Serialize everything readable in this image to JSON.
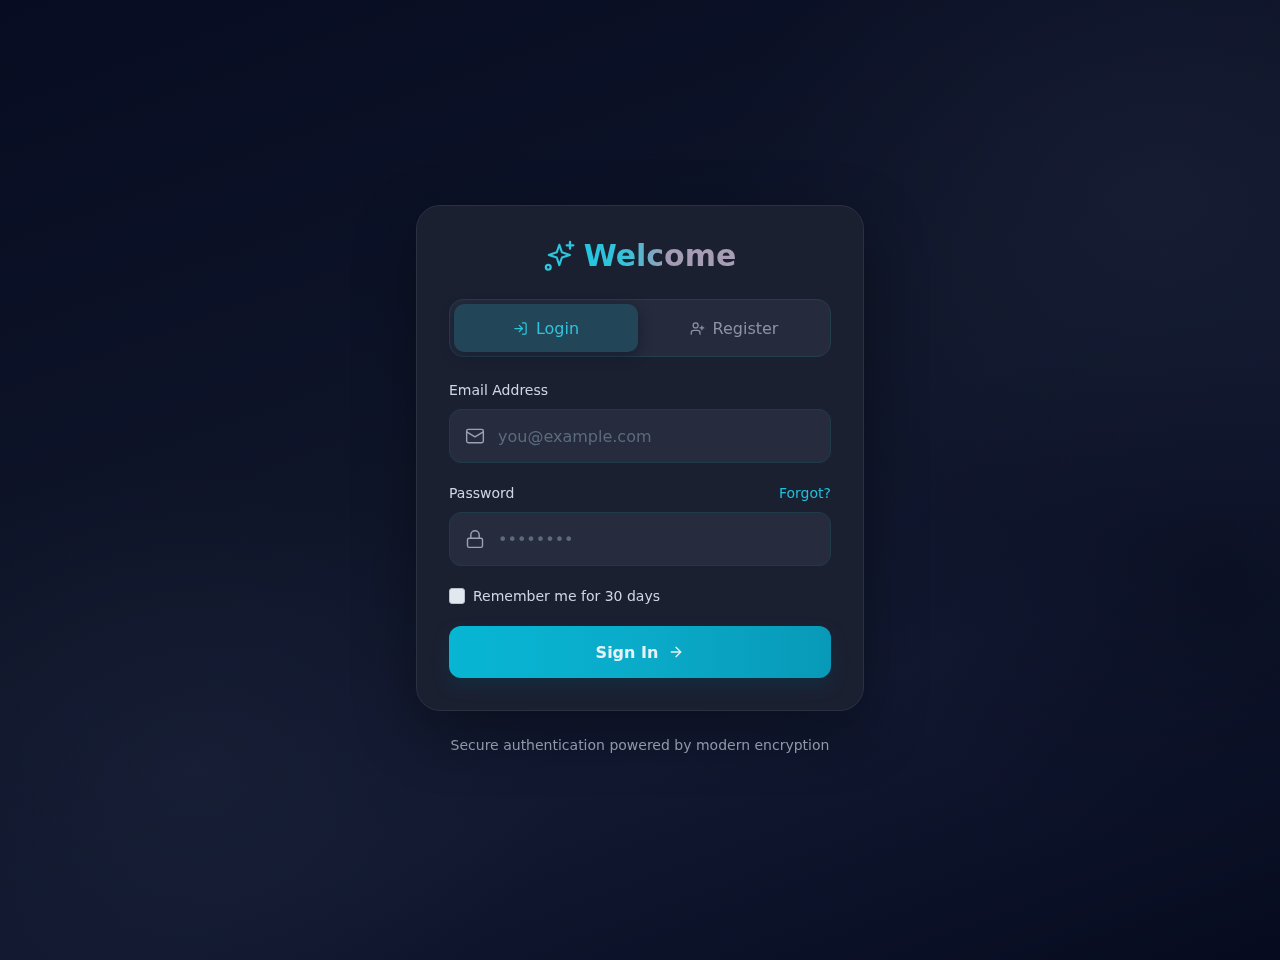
{
  "title": {
    "text": "Welcome"
  },
  "tabs": [
    {
      "label": "Login",
      "selected": true
    },
    {
      "label": "Register",
      "selected": false
    }
  ],
  "fields": [
    {
      "kind": "email",
      "label": "Email Address",
      "placeholder": "you@example.com"
    },
    {
      "kind": "password",
      "label": "Password",
      "link": "Forgot?",
      "placeholder": "••••••••"
    }
  ],
  "remember": {
    "label": "Remember me for 30 days",
    "checked": false
  },
  "submit": {
    "label": "Sign In"
  },
  "footer": {
    "text": "Secure authentication powered by modern encryption"
  }
}
